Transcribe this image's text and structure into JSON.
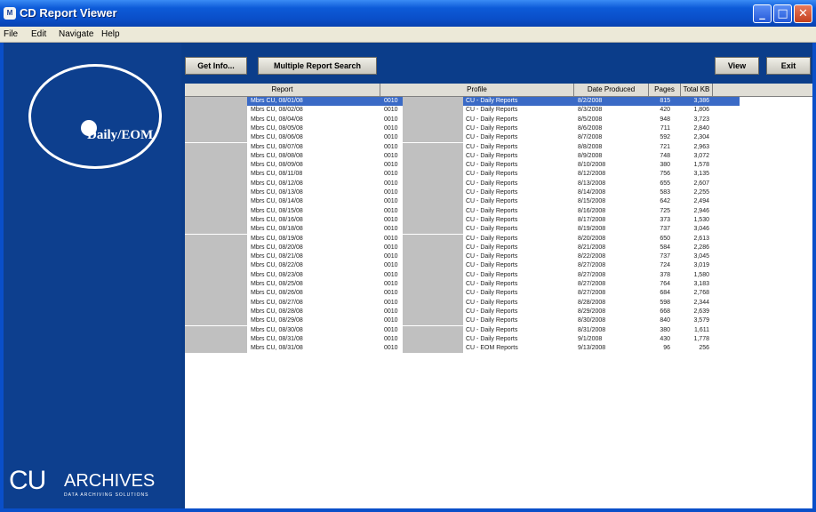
{
  "window": {
    "title": "CD Report Viewer",
    "icon_label": "M"
  },
  "titlebar_buttons": [
    {
      "name": "minimize-button",
      "glyph": "_"
    },
    {
      "name": "maximize-button",
      "glyph": "□"
    },
    {
      "name": "close-button",
      "glyph": "✕"
    }
  ],
  "menu": {
    "file": "File",
    "edit": "Edit",
    "navigate": "Navigate",
    "help": "Help"
  },
  "logo": {
    "disc_label": "Daily/EOM",
    "cu": "CU",
    "archives": "ARCHIVES",
    "tagline": "DATA ARCHIVING SOLUTIONS"
  },
  "toolbar": {
    "get_info": "Get Info...",
    "multi_search": "Multiple Report Search",
    "view": "View",
    "exit": "Exit"
  },
  "table": {
    "columns": {
      "report": "Report",
      "profile": "Profile",
      "date": "Date Produced",
      "pages": "Pages",
      "kb": "Total KB"
    },
    "rows": [
      {
        "report": "Mbrs CU, 08/01/08",
        "code": "0010",
        "profile": "CU - Daily Reports",
        "date": "8/2/2008",
        "pages": "815",
        "kb": "3,386"
      },
      {
        "report": "Mbrs CU, 08/02/08",
        "code": "0010",
        "profile": "CU - Daily Reports",
        "date": "8/3/2008",
        "pages": "420",
        "kb": "1,806"
      },
      {
        "report": "Mbrs CU, 08/04/08",
        "code": "0010",
        "profile": "CU - Daily Reports",
        "date": "8/5/2008",
        "pages": "948",
        "kb": "3,723"
      },
      {
        "report": "Mbrs CU, 08/05/08",
        "code": "0010",
        "profile": "CU - Daily Reports",
        "date": "8/6/2008",
        "pages": "711",
        "kb": "2,840"
      },
      {
        "report": "Mbrs CU, 08/06/08",
        "code": "0010",
        "profile": "CU - Daily Reports",
        "date": "8/7/2008",
        "pages": "592",
        "kb": "2,304"
      },
      {
        "report": "Mbrs CU, 08/07/08",
        "code": "0010",
        "profile": "CU - Daily Reports",
        "date": "8/8/2008",
        "pages": "721",
        "kb": "2,963"
      },
      {
        "report": "Mbrs CU, 08/08/08",
        "code": "0010",
        "profile": "CU - Daily Reports",
        "date": "8/9/2008",
        "pages": "748",
        "kb": "3,072"
      },
      {
        "report": "Mbrs CU, 08/09/08",
        "code": "0010",
        "profile": "CU - Daily Reports",
        "date": "8/10/2008",
        "pages": "380",
        "kb": "1,578"
      },
      {
        "report": "Mbrs CU, 08/11/08",
        "code": "0010",
        "profile": "CU - Daily Reports",
        "date": "8/12/2008",
        "pages": "756",
        "kb": "3,135"
      },
      {
        "report": "Mbrs CU, 08/12/08",
        "code": "0010",
        "profile": "CU - Daily Reports",
        "date": "8/13/2008",
        "pages": "655",
        "kb": "2,607"
      },
      {
        "report": "Mbrs CU, 08/13/08",
        "code": "0010",
        "profile": "CU - Daily Reports",
        "date": "8/14/2008",
        "pages": "583",
        "kb": "2,255"
      },
      {
        "report": "Mbrs CU, 08/14/08",
        "code": "0010",
        "profile": "CU - Daily Reports",
        "date": "8/15/2008",
        "pages": "642",
        "kb": "2,494"
      },
      {
        "report": "Mbrs CU, 08/15/08",
        "code": "0010",
        "profile": "CU - Daily Reports",
        "date": "8/16/2008",
        "pages": "725",
        "kb": "2,946"
      },
      {
        "report": "Mbrs CU, 08/16/08",
        "code": "0010",
        "profile": "CU - Daily Reports",
        "date": "8/17/2008",
        "pages": "373",
        "kb": "1,530"
      },
      {
        "report": "Mbrs CU, 08/18/08",
        "code": "0010",
        "profile": "CU - Daily Reports",
        "date": "8/19/2008",
        "pages": "737",
        "kb": "3,046"
      },
      {
        "report": "Mbrs CU, 08/19/08",
        "code": "0010",
        "profile": "CU - Daily Reports",
        "date": "8/20/2008",
        "pages": "650",
        "kb": "2,613"
      },
      {
        "report": "Mbrs CU, 08/20/08",
        "code": "0010",
        "profile": "CU - Daily Reports",
        "date": "8/21/2008",
        "pages": "584",
        "kb": "2,286"
      },
      {
        "report": "Mbrs CU, 08/21/08",
        "code": "0010",
        "profile": "CU - Daily Reports",
        "date": "8/22/2008",
        "pages": "737",
        "kb": "3,045"
      },
      {
        "report": "Mbrs CU, 08/22/08",
        "code": "0010",
        "profile": "CU - Daily Reports",
        "date": "8/27/2008",
        "pages": "724",
        "kb": "3,019"
      },
      {
        "report": "Mbrs CU, 08/23/08",
        "code": "0010",
        "profile": "CU - Daily Reports",
        "date": "8/27/2008",
        "pages": "378",
        "kb": "1,580"
      },
      {
        "report": "Mbrs CU, 08/25/08",
        "code": "0010",
        "profile": "CU - Daily Reports",
        "date": "8/27/2008",
        "pages": "764",
        "kb": "3,183"
      },
      {
        "report": "Mbrs CU, 08/26/08",
        "code": "0010",
        "profile": "CU - Daily Reports",
        "date": "8/27/2008",
        "pages": "684",
        "kb": "2,768"
      },
      {
        "report": "Mbrs CU, 08/27/08",
        "code": "0010",
        "profile": "CU - Daily Reports",
        "date": "8/28/2008",
        "pages": "598",
        "kb": "2,344"
      },
      {
        "report": "Mbrs CU, 08/28/08",
        "code": "0010",
        "profile": "CU - Daily Reports",
        "date": "8/29/2008",
        "pages": "668",
        "kb": "2,639"
      },
      {
        "report": "Mbrs CU, 08/29/08",
        "code": "0010",
        "profile": "CU - Daily Reports",
        "date": "8/30/2008",
        "pages": "840",
        "kb": "3,579"
      },
      {
        "report": "Mbrs CU, 08/30/08",
        "code": "0010",
        "profile": "CU - Daily Reports",
        "date": "8/31/2008",
        "pages": "380",
        "kb": "1,611"
      },
      {
        "report": "Mbrs CU, 08/31/08",
        "code": "0010",
        "profile": "CU - Daily Reports",
        "date": "9/1/2008",
        "pages": "430",
        "kb": "1,778"
      },
      {
        "report": "Mbrs CU, 08/31/08",
        "code": "0010",
        "profile": "CU - EOM Reports",
        "date": "9/13/2008",
        "pages": "96",
        "kb": "256"
      }
    ]
  },
  "colors": {
    "panel_blue": "#0d3f8e",
    "title_blue": "#0a4fc9",
    "selection": "#3a6ac6"
  }
}
